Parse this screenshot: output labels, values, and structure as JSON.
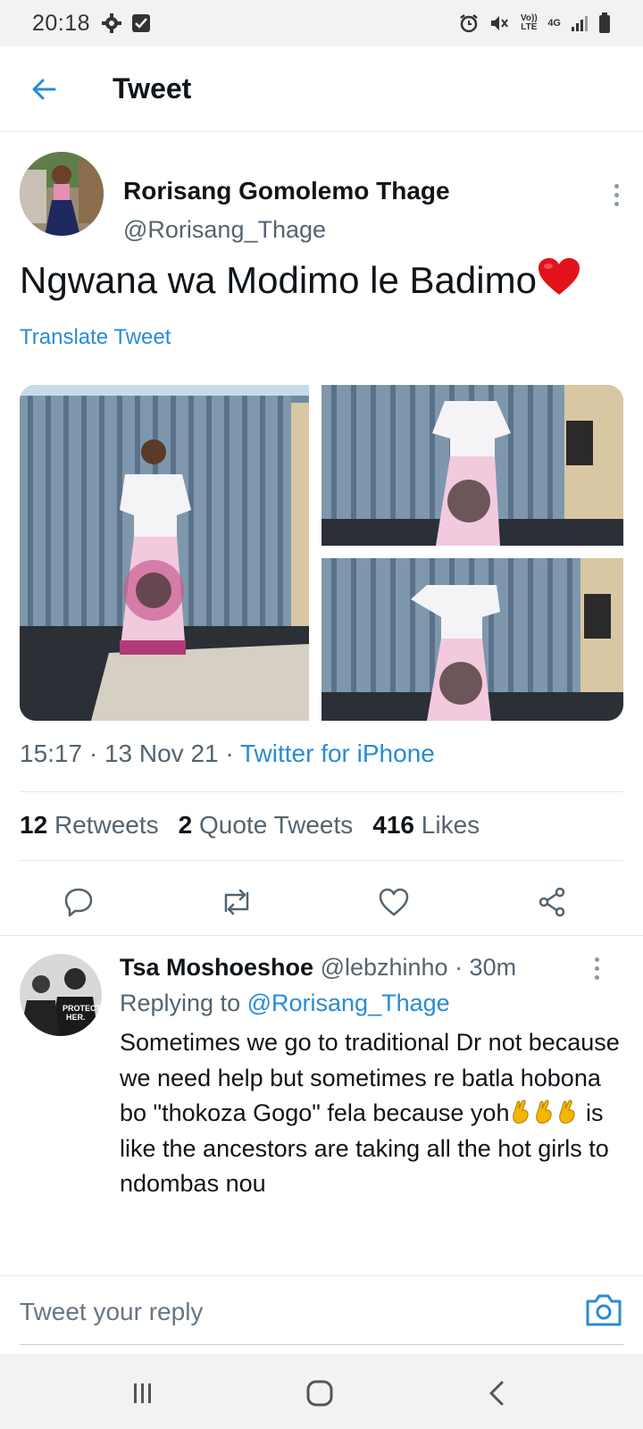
{
  "status_bar": {
    "time": "20:18",
    "left_icons": [
      "gear-icon",
      "checkbox-notification-icon"
    ],
    "right_icons": [
      "alarm-icon",
      "mute-icon",
      "volte-icon",
      "4g-icon",
      "signal-icon",
      "battery-icon"
    ],
    "volte_label": "Vo)) LTE",
    "network_label": "4G"
  },
  "header": {
    "title": "Tweet"
  },
  "tweet": {
    "author_name": "Rorisang Gomolemo Thage",
    "author_handle": "@Rorisang_Thage",
    "text": "Ngwana wa Modimo le Badimo",
    "translate_label": "Translate Tweet",
    "timestamp": "15:17 · 13 Nov 21 · ",
    "source": "Twitter for iPhone",
    "stats": {
      "retweets_count": "12",
      "retweets_label": "Retweets",
      "quotes_count": "2",
      "quotes_label": "Quote Tweets",
      "likes_count": "416",
      "likes_label": "Likes"
    }
  },
  "reply": {
    "name": "Tsa Moshoeshoe",
    "handle_time": "@lebzhinho · 30m",
    "replying_prefix": "Replying to",
    "replying_to": "@Rorisang_Thage",
    "text_part1": "Sometimes we go to traditional Dr not because we need help but sometimes re batla hobona bo \"thokoza Gogo\" fela because yoh",
    "text_part2": " is like the ancestors are taking all the hot girls to ndombas nou",
    "avatar_text_1": "PROTECT",
    "avatar_text_2": "HER."
  },
  "compose": {
    "placeholder": "Tweet your reply"
  },
  "colors": {
    "accent": "#2a8bd6",
    "text_primary": "#0f1419",
    "text_secondary": "#536471",
    "heart": "#e0245e"
  }
}
